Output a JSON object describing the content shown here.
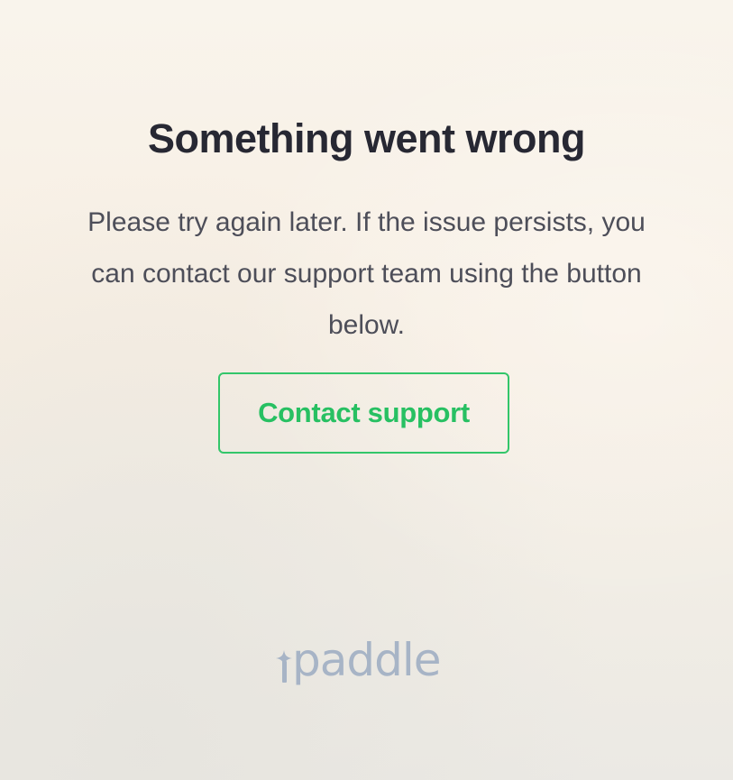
{
  "error": {
    "title": "Something went wrong",
    "message": "Please try again later. If the issue persists, you can contact our support team using the button below."
  },
  "actions": {
    "contact_label": "Contact support"
  },
  "brand": {
    "logo_text": "paddle",
    "logo_color": "#a7b4c6",
    "accent_color": "#27c062"
  }
}
